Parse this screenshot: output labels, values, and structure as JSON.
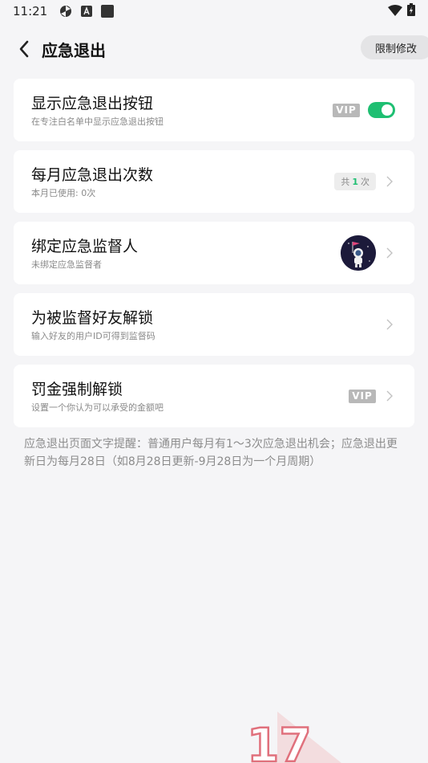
{
  "status_bar": {
    "time": "11:21"
  },
  "header": {
    "title": "应急退出",
    "limit_button": "限制修改"
  },
  "settings": [
    {
      "title": "显示应急退出按钮",
      "subtitle": "在专注白名单中显示应急退出按钮",
      "badge": "VIP",
      "toggle_on": true
    },
    {
      "title": "每月应急退出次数",
      "subtitle": "本月已使用: 0次",
      "count_prefix": "共",
      "count_value": "1",
      "count_suffix": "次"
    },
    {
      "title": "绑定应急监督人",
      "subtitle": "未绑定应急监督者"
    },
    {
      "title": "为被监督好友解锁",
      "subtitle": "输入好友的用户ID可得到监督码"
    },
    {
      "title": "罚金强制解锁",
      "subtitle": "设置一个你认为可以承受的金额吧",
      "badge": "VIP"
    }
  ],
  "note": "应急退出页面文字提醒：普通用户每月有1～3次应急退出机会；应急退出更新日为每月28日（如8月28日更新-9月28日为一个月周期）",
  "watermark": "17",
  "colors": {
    "accent": "#1fbf72",
    "background": "#f5f5f7",
    "card": "#ffffff",
    "vip": "#b8b8b8"
  },
  "icons": [
    "pinwheel-icon",
    "a-icon",
    "square-icon",
    "wifi-icon",
    "battery-icon",
    "back-arrow-icon",
    "chevron-right-icon",
    "astronaut-avatar"
  ]
}
